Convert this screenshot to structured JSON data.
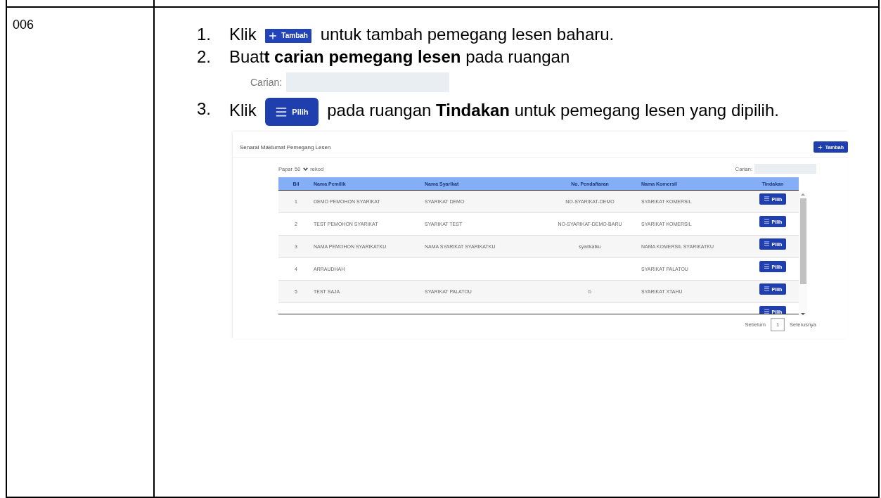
{
  "row_number": "006",
  "steps": [
    {
      "number": "1.",
      "kind": "add_button",
      "before": "Klik",
      "button": {
        "label": "Tambah"
      },
      "after": "untuk tambah pemegang lesen baharu."
    },
    {
      "number": "2.",
      "kind": "search",
      "text": "Buat**t carian pemegang lesen** pada ruangan",
      "search_label": "Carian:"
    },
    {
      "number": "3.",
      "kind": "select_button",
      "before": "Klik",
      "button": {
        "label": "Pilih"
      },
      "after": "pada ruangan **Tindakan** untuk pemegang lesen yang dipilih."
    }
  ],
  "screenshot": {
    "title": "Senarai Maklumat Pemegang Lesen",
    "add_button": {
      "label": "Tambah"
    },
    "page_size": {
      "prefix": "Papar",
      "value": "50",
      "suffix": "rekod"
    },
    "search_label": "Carian:",
    "columns": [
      "Bil",
      "Nama Pemilik",
      "Nama Syarikat",
      "No. Pendaftaran",
      "Nama Komersil",
      "Tindakan"
    ],
    "rows": [
      {
        "cells": [
          "1",
          "DEMO PEMOHON SYARIKAT",
          "SYARIKAT DEMO",
          "NO-SYARIKAT-DEMO",
          "SYARIKAT KOMERSIL"
        ],
        "action": "Pilih"
      },
      {
        "cells": [
          "2",
          "TEST PEMOHON SYARIKAT",
          "SYARIKAT TEST",
          "NO-SYARIKAT-DEMO-BARU",
          "SYARIKAT KOMERSIL"
        ],
        "action": "Pilih"
      },
      {
        "cells": [
          "3",
          "NAMA PEMOHON SYARIKATKU",
          "NAMA SYARIKAT SYARIKATKU",
          "syarikatku",
          "NAMA KOMERSIL SYARIKATKU"
        ],
        "action": "Pilih"
      },
      {
        "cells": [
          "4",
          "ARRAUDHAH",
          "",
          "",
          "SYARIKAT PALATOU"
        ],
        "action": "Pilih"
      },
      {
        "cells": [
          "5",
          "TEST SAJA",
          "SYARIKAT PALATOU",
          "b",
          "SYARIKAT XTAHU"
        ],
        "action": "Pilih"
      },
      {
        "cells": [
          "",
          "",
          "",
          "",
          ""
        ],
        "action": "Pilih"
      }
    ],
    "pagination": {
      "previous": "Sebelum",
      "pages": [
        {
          "label": "1",
          "selected": true
        }
      ],
      "next": "Seterusnya"
    }
  }
}
